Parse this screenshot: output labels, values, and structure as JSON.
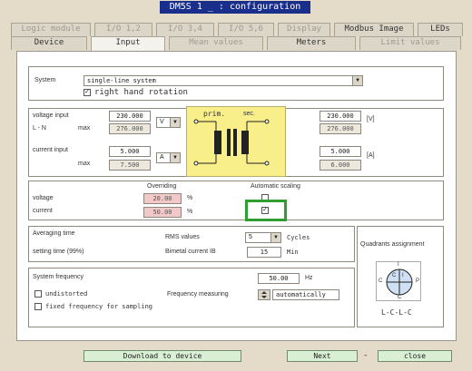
{
  "window": {
    "title": "DM5S 1 _  : configuration"
  },
  "tabs_row1": [
    "Logic module",
    "I/O 1,2",
    "I/O 3,4",
    "I/O 5,6",
    "Display",
    "Modbus Image",
    "LEDs"
  ],
  "tabs_row2": [
    "Device",
    "Input",
    "Mean values",
    "Meters",
    "Limit values"
  ],
  "system": {
    "label": "System",
    "value": "single-line system",
    "right_hand_rotation_label": "right hand rotation",
    "right_hand_rotation_checked": "✓"
  },
  "voltage_input": {
    "title": "voltage input",
    "sub": "L - N",
    "max_label": "max",
    "primary": "230.000",
    "primary_max": "276.000",
    "primary_unit": "V",
    "secondary": "230.000",
    "secondary_max": "276.000",
    "secondary_unit": "[V]"
  },
  "current_input": {
    "title": "current input",
    "max_label": "max",
    "primary": "5.000",
    "primary_max": "7.500",
    "primary_unit": "A",
    "secondary": "5.000",
    "secondary_max": "6.000",
    "secondary_unit": "[A]"
  },
  "transformer": {
    "prim": "prim.",
    "sec": "sec."
  },
  "overriding": {
    "header": "Overriding",
    "scaling_header": "Automatic scaling",
    "voltage_label": "voltage",
    "voltage_value": "20.00",
    "current_label": "current",
    "current_value": "50.00",
    "unit": "%",
    "current_scaling_checked": "✓"
  },
  "averaging": {
    "title": "Averaging time",
    "setting_time_label": "setting time (99%)",
    "rms_label": "RMS values",
    "rms_value": "5",
    "rms_unit": "Cycles",
    "bimetal_label": "Bimetal current IB",
    "bimetal_value": "15",
    "bimetal_unit": "Min"
  },
  "quadrants": {
    "title": "Quadrants assignment",
    "letters": {
      "top": "I",
      "left": "C",
      "right": "P",
      "bottom": "C",
      "center_left": "C",
      "center_right": "I"
    },
    "caption": "L-C-L-C"
  },
  "frequency": {
    "title": "System frequency",
    "value": "50.00",
    "unit": "Hz",
    "undistorted_label": "undistorted",
    "fixed_label": "fixed frequency for sampling",
    "measuring_label": "Frequency measuring",
    "measuring_value": "automatically"
  },
  "buttons": {
    "download": "Download to device",
    "next": "Next",
    "dash": "-",
    "close": "close"
  },
  "colors": {
    "highlight": "#2e9e2e",
    "title_bg": "#1a2f8c",
    "transformer_bg": "#f8ef8a"
  }
}
